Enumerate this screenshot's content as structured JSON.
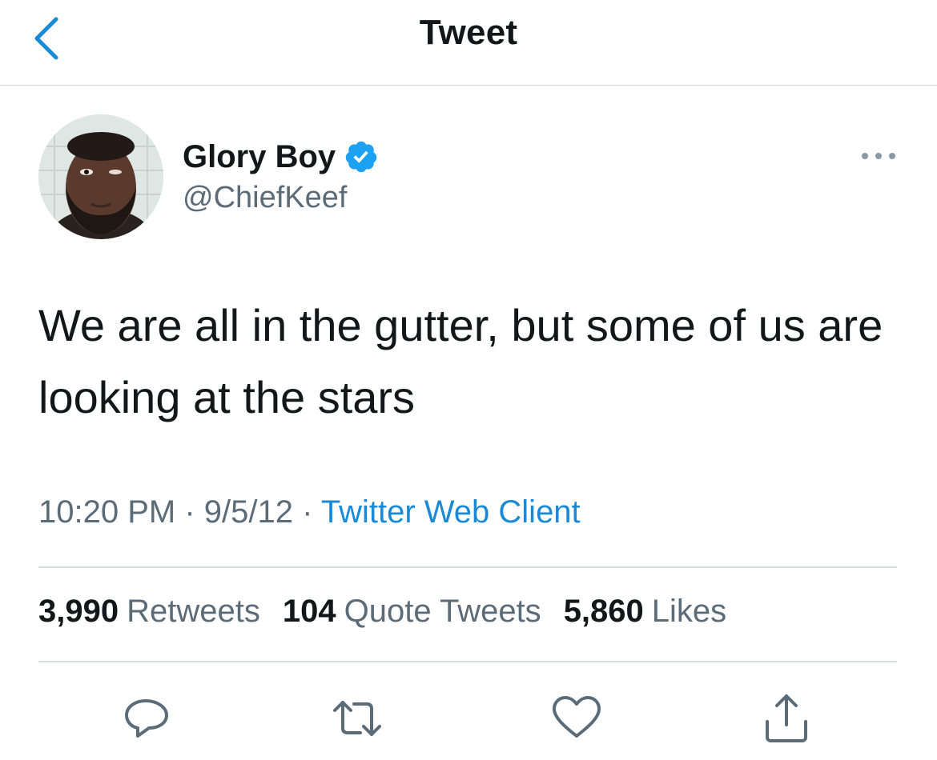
{
  "header": {
    "title": "Tweet",
    "back_icon": "chevron-left-icon"
  },
  "author": {
    "name": "Glory Boy",
    "handle": "@ChiefKeef",
    "verified": true,
    "verified_color": "#1da1f2"
  },
  "tweet": {
    "text": "We are all in the gutter, but some of us are looking at the stars"
  },
  "meta": {
    "time": "10:20 PM",
    "separator": "·",
    "date": "9/5/12",
    "source": "Twitter Web Client"
  },
  "stats": [
    {
      "count": "3,990",
      "label": "Retweets"
    },
    {
      "count": "104",
      "label": "Quote Tweets"
    },
    {
      "count": "5,860",
      "label": "Likes"
    }
  ],
  "actions": [
    "reply-icon",
    "retweet-icon",
    "like-icon",
    "share-icon"
  ],
  "colors": {
    "accent": "#1b8ad6",
    "text_primary": "#14171a",
    "text_secondary": "#5b6b78",
    "divider": "#d9dde1"
  }
}
